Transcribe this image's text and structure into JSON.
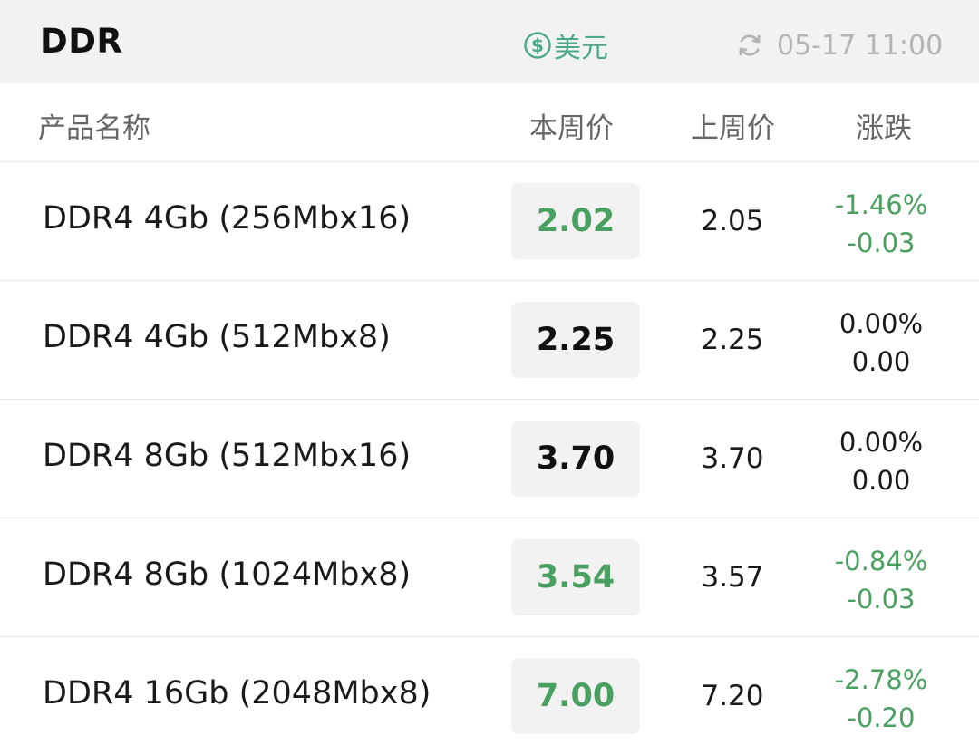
{
  "header": {
    "title": "DDR",
    "currency_label": "美元",
    "currency_icon": "dollar-circle-icon",
    "updated_time": "05-17 11:00",
    "refresh_icon": "refresh-icon"
  },
  "columns": {
    "name": "产品名称",
    "this_week": "本周价",
    "last_week": "上周价",
    "change": "涨跌"
  },
  "colors": {
    "down": "#4aa060",
    "flat": "#111111",
    "accent": "#4aa88a"
  },
  "rows": [
    {
      "name": "DDR4 4Gb (256Mbx16)",
      "this_week": "2.02",
      "last_week": "2.05",
      "change_pct": "-1.46%",
      "change_abs": "-0.03",
      "trend": "down"
    },
    {
      "name": "DDR4 4Gb (512Mbx8)",
      "this_week": "2.25",
      "last_week": "2.25",
      "change_pct": "0.00%",
      "change_abs": "0.00",
      "trend": "flat"
    },
    {
      "name": "DDR4 8Gb (512Mbx16)",
      "this_week": "3.70",
      "last_week": "3.70",
      "change_pct": "0.00%",
      "change_abs": "0.00",
      "trend": "flat"
    },
    {
      "name": "DDR4 8Gb (1024Mbx8)",
      "this_week": "3.54",
      "last_week": "3.57",
      "change_pct": "-0.84%",
      "change_abs": "-0.03",
      "trend": "down"
    },
    {
      "name": "DDR4 16Gb (2048Mbx8)",
      "this_week": "7.00",
      "last_week": "7.20",
      "change_pct": "-2.78%",
      "change_abs": "-0.20",
      "trend": "down"
    }
  ]
}
